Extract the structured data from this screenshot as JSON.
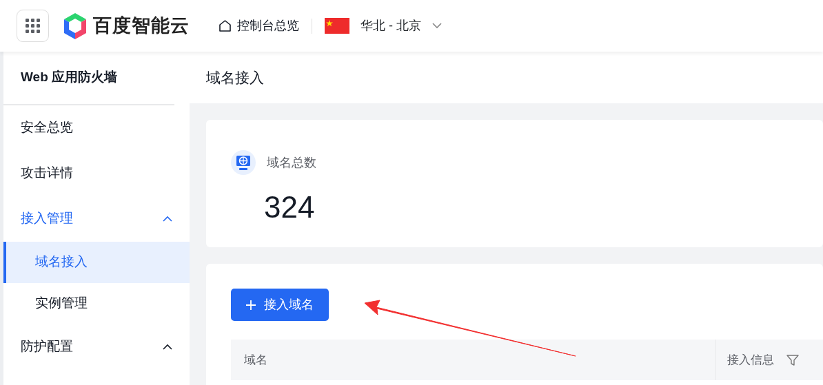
{
  "header": {
    "brand": "百度智能云",
    "console_link": "控制台总览",
    "region": "华北 - 北京"
  },
  "sidebar": {
    "title": "Web 应用防火墙",
    "items": [
      {
        "label": "安全总览",
        "selected": false
      },
      {
        "label": "攻击详情",
        "selected": false
      },
      {
        "label": "接入管理",
        "selected": true,
        "expanded": true,
        "children": [
          {
            "label": "域名接入",
            "selected": true
          },
          {
            "label": "实例管理",
            "selected": false
          }
        ]
      },
      {
        "label": "防护配置",
        "selected": false,
        "expanded": true
      }
    ]
  },
  "page_title": "域名接入",
  "stat": {
    "label": "域名总数",
    "value": "324"
  },
  "add_button": "接入域名",
  "table": {
    "columns": [
      {
        "label": "域名",
        "filter": false
      },
      {
        "label": "接入信息",
        "filter": true
      }
    ]
  }
}
